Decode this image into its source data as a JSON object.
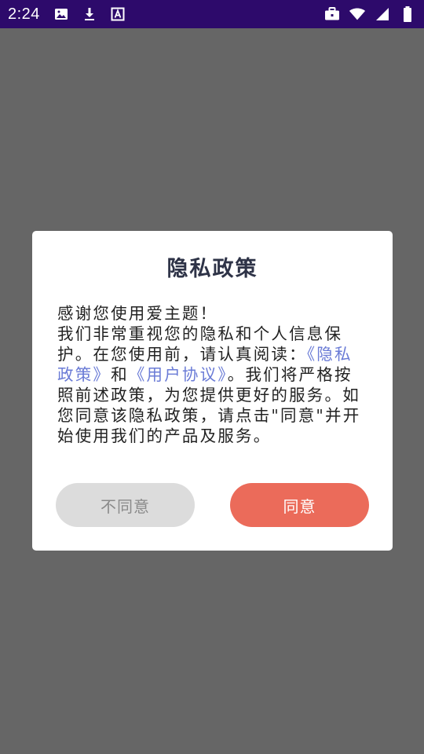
{
  "status_bar": {
    "time": "2:24",
    "left_icons": [
      "image-icon",
      "download-icon",
      "font-icon"
    ],
    "right_icons": [
      "briefcase-icon",
      "wifi-icon",
      "signal-icon",
      "battery-icon"
    ],
    "background": "#2d0a6b"
  },
  "dialog": {
    "title": "隐私政策",
    "body": {
      "greeting": "感谢您使用爱主题！",
      "text_before": "我们非常重视您的隐私和个人信息保护。在您使用前，请认真阅读：",
      "privacy_link": "《隐私政策》",
      "conjunction": "和",
      "user_agreement_link": "《用户协议》",
      "text_after": "。我们将严格按照前述政策，为您提供更好的服务。如您同意该隐私政策，请点击\"同意\"并开始使用我们的产品及服务。"
    },
    "buttons": {
      "disagree_label": "不同意",
      "agree_label": "同意"
    },
    "colors": {
      "link": "#6a7bd6",
      "agree_button": "#eb6b5a",
      "disagree_button": "#dcdcdc"
    }
  }
}
